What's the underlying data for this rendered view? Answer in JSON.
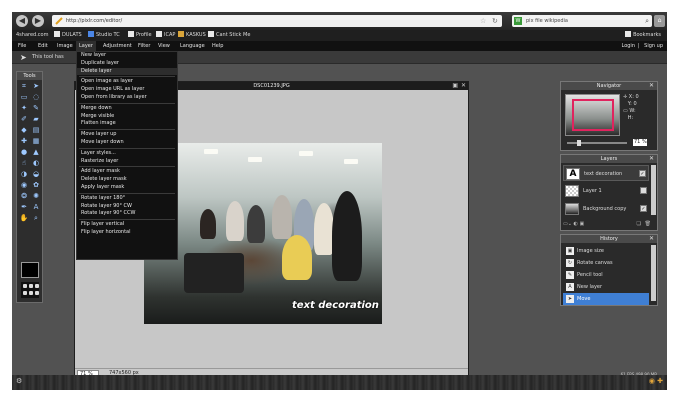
{
  "browser": {
    "url": "http://pixlr.com/editor/",
    "search_value": "pix file wikipedia"
  },
  "bookmarks": {
    "items": [
      "4shared.com",
      "DULATS",
      "Studio TC",
      "Profile",
      "ICAP",
      "KASKUS",
      "Cant Stick Me"
    ],
    "right_label": "Bookmarks"
  },
  "menu": {
    "items": [
      "File",
      "Edit",
      "Image",
      "Layer",
      "Adjustment",
      "Filter",
      "View",
      "Language",
      "Help"
    ],
    "login": "Login",
    "signup": "Sign up"
  },
  "options_bar": {
    "hint": "This tool has"
  },
  "tools": {
    "title": "Tools"
  },
  "document": {
    "title": "DSC01239.JPG",
    "zoom": "71",
    "zoom_unit": "%",
    "size": "747x560 px",
    "caption": "text decoration"
  },
  "layer_menu": {
    "groups": [
      [
        "New layer",
        "Duplicate layer",
        "Delete layer"
      ],
      [
        "Open image as layer",
        "Open image URL as layer",
        "Open from library as layer"
      ],
      [
        "Merge down",
        "Merge visible",
        "Flatten image"
      ],
      [
        "Move layer up",
        "Move layer down"
      ],
      [
        "Layer styles...",
        "Rasterize layer"
      ],
      [
        "Add layer mask",
        "Delete layer mask",
        "Apply layer mask"
      ],
      [
        "Rotate layer 180°",
        "Rotate layer 90° CW",
        "Rotate layer 90° CCW"
      ],
      [
        "Flip layer vertical",
        "Flip layer horizontal"
      ]
    ]
  },
  "navigator": {
    "title": "Navigator",
    "x_label": "X:",
    "x_value": "0",
    "y_label": "Y:",
    "y_value": "0",
    "w_label": "W:",
    "h_label": "H:",
    "zoom": "71",
    "zoom_unit": "%"
  },
  "layers": {
    "title": "Layers",
    "items": [
      {
        "name": "text decoration",
        "checked": "✓"
      },
      {
        "name": "Layer 1",
        "checked": ""
      },
      {
        "name": "Background copy",
        "checked": "✓"
      }
    ]
  },
  "history": {
    "title": "History",
    "items": [
      "Image size",
      "Rotate canvas",
      "Pencil tool",
      "New layer",
      "Move"
    ]
  },
  "status": {
    "fps": "61 FPS 498.90 MB"
  },
  "colors": {
    "accent": "#3f7fd4",
    "nav_viewbox": "#e0245e"
  }
}
